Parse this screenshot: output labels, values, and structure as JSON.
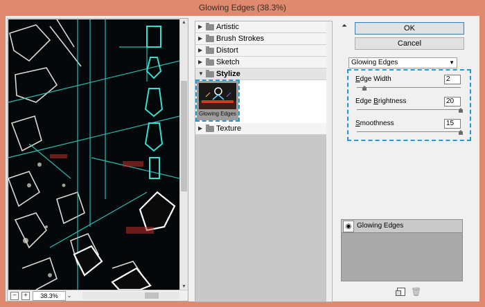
{
  "window": {
    "title": "Glowing Edges (38.3%)"
  },
  "preview": {
    "zoom": "38.3%",
    "zoom_out_icon": "minus-icon",
    "zoom_in_icon": "plus-icon"
  },
  "gallery": {
    "categories": [
      {
        "label": "Artistic",
        "open": false
      },
      {
        "label": "Brush Strokes",
        "open": false
      },
      {
        "label": "Distort",
        "open": false
      },
      {
        "label": "Sketch",
        "open": false
      },
      {
        "label": "Stylize",
        "open": true
      },
      {
        "label": "Texture",
        "open": false
      }
    ],
    "selected_filter": {
      "label": "Glowing Edges"
    }
  },
  "buttons": {
    "ok": "OK",
    "cancel": "Cancel"
  },
  "filter_select": {
    "value": "Glowing Edges"
  },
  "params": [
    {
      "mnemonic": "E",
      "rest": "dge Width",
      "value": "2",
      "fraction": 0.07
    },
    {
      "mnemonic": "B",
      "rest_before": "Edge ",
      "rest": "rightness",
      "value": "20",
      "fraction": 1.0
    },
    {
      "mnemonic": "S",
      "rest": "moothness",
      "value": "15",
      "fraction": 1.0
    }
  ],
  "layers": [
    {
      "name": "Glowing Edges",
      "visible": true
    }
  ],
  "accent": "#1a9ad9"
}
